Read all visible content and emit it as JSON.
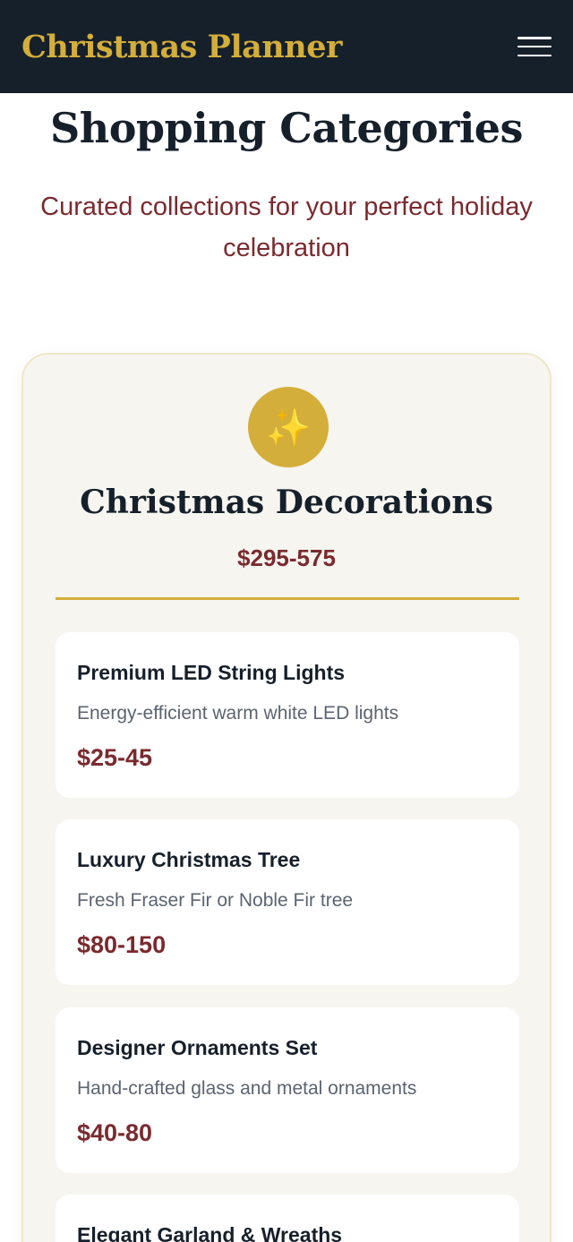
{
  "navbar": {
    "brand": "Christmas Planner",
    "menu_icon": "hamburger-menu-icon"
  },
  "page": {
    "title": "Shopping Categories",
    "subtitle": "Curated collections for your perfect holiday celebration"
  },
  "category": {
    "icon": "sparkles-icon",
    "icon_glyph": "✨",
    "title": "Christmas Decorations",
    "price_range": "$295-575",
    "items": [
      {
        "name": "Premium LED String Lights",
        "description": "Energy-efficient warm white LED lights",
        "price": "$25-45"
      },
      {
        "name": "Luxury Christmas Tree",
        "description": "Fresh Fraser Fir or Noble Fir tree",
        "price": "$80-150"
      },
      {
        "name": "Designer Ornaments Set",
        "description": "Hand-crafted glass and metal ornaments",
        "price": "$40-80"
      },
      {
        "name": "Elegant Garland & Wreaths",
        "description": "",
        "price": ""
      }
    ]
  },
  "colors": {
    "navbar_bg": "#16202b",
    "gold": "#d4ae3a",
    "accent_red": "#7a2a2e",
    "card_bg": "#f6f5f0"
  }
}
